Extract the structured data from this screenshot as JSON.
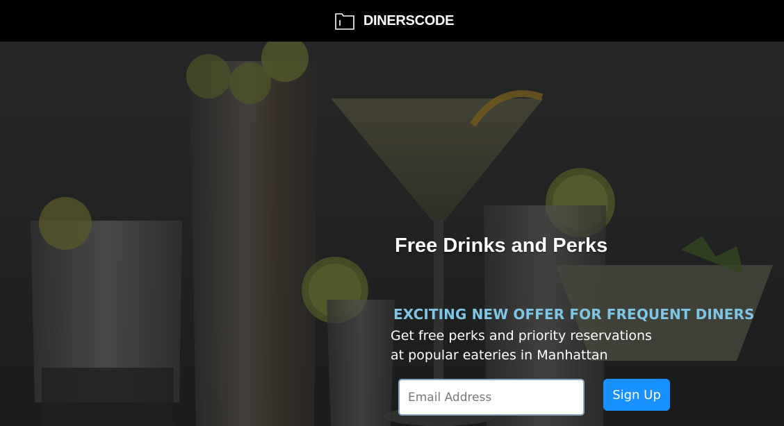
{
  "header": {
    "logo_icon": "folder-icon",
    "brand": "DINERSCODE"
  },
  "hero": {
    "headline": "Free Drinks and Perks",
    "offer_title": "EXCITING NEW OFFER FOR FREQUENT DINERS",
    "offer_description": "Get free perks and priority reservations at popular eateries in Manhattan",
    "email_placeholder": "Email Address",
    "signup_label": "Sign Up",
    "accent_color": "#7ec5e6",
    "button_color": "#1890ff"
  }
}
